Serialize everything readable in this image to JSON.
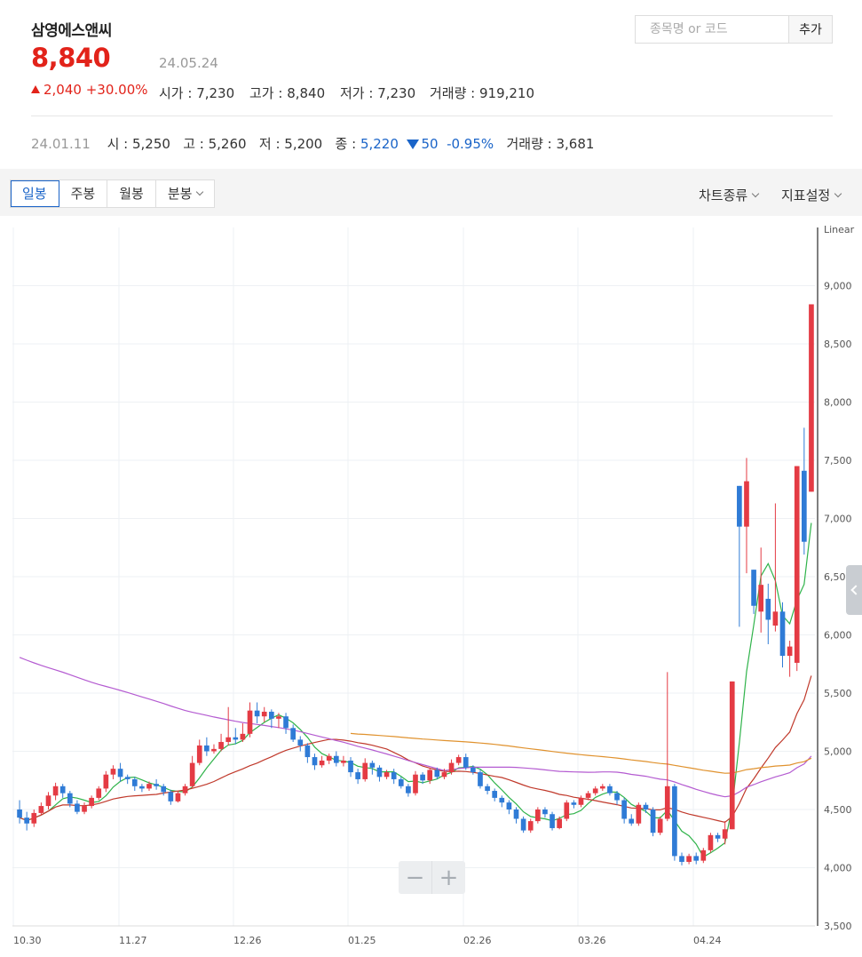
{
  "header": {
    "name": "삼영에스앤씨",
    "price": "8,840",
    "date": "24.05.24",
    "change": "2,040",
    "change_pct": "+30.00%",
    "open": "시가 : 7,230",
    "high": "고가 : 8,840",
    "low": "저가 : 7,230",
    "volume": "거래량 : 919,210"
  },
  "search": {
    "placeholder": "종목명 or 코드",
    "add_label": "추가"
  },
  "hover": {
    "date": "24.01.11",
    "open": "시 : 5,250",
    "high": "고 : 5,260",
    "low": "저 : 5,200",
    "close_label": "종 : ",
    "close": "5,220",
    "change": "50",
    "change_pct": "-0.95%",
    "volume": "거래량 : 3,681"
  },
  "tabs": [
    {
      "label": "일봉",
      "active": true
    },
    {
      "label": "주봉"
    },
    {
      "label": "월봉"
    },
    {
      "label": "분봉",
      "dropdown": true
    }
  ],
  "toolbar_right": {
    "chart_type": "차트종류",
    "indicator": "지표설정"
  },
  "zoom": {
    "minus": "−",
    "plus": "+"
  },
  "colors": {
    "up": "#e43b44",
    "down": "#2f7bd6",
    "ma5": "#2fb34a",
    "ma20": "#c0392b",
    "ma60": "#b45bd1",
    "ma120": "#e0922e"
  },
  "chart_data": {
    "type": "candlestick",
    "scale_label": "Linear",
    "ylim": [
      3500,
      9500
    ],
    "y_ticks": [
      "9,000",
      "8,500",
      "8,000",
      "7,500",
      "7,000",
      "6,500",
      "6,000",
      "5,500",
      "5,000",
      "4,500",
      "4,000",
      "3,500"
    ],
    "x_ticks": [
      "10.30",
      "11.27",
      "12.26",
      "01.25",
      "02.26",
      "03.26",
      "04.24"
    ],
    "candles": [
      [
        4500,
        4430,
        4580,
        4380
      ],
      [
        4430,
        4380,
        4480,
        4320
      ],
      [
        4380,
        4470,
        4500,
        4350
      ],
      [
        4470,
        4530,
        4560,
        4450
      ],
      [
        4530,
        4620,
        4650,
        4500
      ],
      [
        4620,
        4700,
        4730,
        4580
      ],
      [
        4700,
        4640,
        4720,
        4600
      ],
      [
        4640,
        4550,
        4660,
        4520
      ],
      [
        4550,
        4480,
        4580,
        4460
      ],
      [
        4480,
        4530,
        4560,
        4460
      ],
      [
        4530,
        4600,
        4620,
        4510
      ],
      [
        4600,
        4680,
        4700,
        4580
      ],
      [
        4680,
        4800,
        4830,
        4650
      ],
      [
        4800,
        4850,
        4880,
        4760
      ],
      [
        4850,
        4780,
        4900,
        4740
      ],
      [
        4780,
        4760,
        4800,
        4720
      ],
      [
        4760,
        4700,
        4780,
        4660
      ],
      [
        4700,
        4680,
        4720,
        4650
      ],
      [
        4680,
        4720,
        4740,
        4660
      ],
      [
        4720,
        4700,
        4760,
        4670
      ],
      [
        4700,
        4650,
        4720,
        4620
      ],
      [
        4650,
        4570,
        4670,
        4540
      ],
      [
        4570,
        4640,
        4660,
        4560
      ],
      [
        4640,
        4700,
        4720,
        4620
      ],
      [
        4700,
        4900,
        4960,
        4680
      ],
      [
        4900,
        5050,
        5100,
        4880
      ],
      [
        5050,
        5000,
        5120,
        4960
      ],
      [
        5000,
        5020,
        5060,
        4980
      ],
      [
        5020,
        5080,
        5150,
        5000
      ],
      [
        5080,
        5120,
        5380,
        5050
      ],
      [
        5120,
        5100,
        5200,
        5060
      ],
      [
        5100,
        5150,
        5240,
        5080
      ],
      [
        5150,
        5350,
        5420,
        5120
      ],
      [
        5350,
        5300,
        5420,
        5240
      ],
      [
        5300,
        5340,
        5380,
        5250
      ],
      [
        5340,
        5280,
        5360,
        5200
      ],
      [
        5280,
        5300,
        5330,
        5200
      ],
      [
        5300,
        5200,
        5330,
        5150
      ],
      [
        5200,
        5100,
        5230,
        5080
      ],
      [
        5100,
        5050,
        5130,
        5000
      ],
      [
        5050,
        4950,
        5070,
        4900
      ],
      [
        4950,
        4880,
        4980,
        4840
      ],
      [
        4880,
        4920,
        4960,
        4860
      ],
      [
        4920,
        4960,
        4980,
        4890
      ],
      [
        4960,
        4900,
        5000,
        4870
      ],
      [
        4900,
        4920,
        4960,
        4870
      ],
      [
        4920,
        4820,
        4950,
        4780
      ],
      [
        4820,
        4760,
        4850,
        4720
      ],
      [
        4760,
        4900,
        4940,
        4740
      ],
      [
        4900,
        4860,
        4920,
        4800
      ],
      [
        4860,
        4780,
        4880,
        4740
      ],
      [
        4780,
        4820,
        4840,
        4760
      ],
      [
        4820,
        4760,
        4850,
        4720
      ],
      [
        4760,
        4700,
        4780,
        4680
      ],
      [
        4700,
        4640,
        4720,
        4610
      ],
      [
        4640,
        4800,
        4830,
        4620
      ],
      [
        4800,
        4750,
        4820,
        4720
      ],
      [
        4750,
        4840,
        4860,
        4720
      ],
      [
        4840,
        4780,
        4860,
        4760
      ],
      [
        4780,
        4820,
        4850,
        4760
      ],
      [
        4820,
        4900,
        4930,
        4800
      ],
      [
        4900,
        4950,
        4970,
        4880
      ],
      [
        4950,
        4860,
        4980,
        4840
      ],
      [
        4860,
        4820,
        4880,
        4800
      ],
      [
        4820,
        4700,
        4840,
        4680
      ],
      [
        4700,
        4660,
        4720,
        4630
      ],
      [
        4660,
        4600,
        4680,
        4570
      ],
      [
        4600,
        4560,
        4620,
        4520
      ],
      [
        4560,
        4500,
        4580,
        4460
      ],
      [
        4500,
        4420,
        4520,
        4380
      ],
      [
        4420,
        4320,
        4440,
        4300
      ],
      [
        4320,
        4400,
        4420,
        4300
      ],
      [
        4400,
        4500,
        4520,
        4380
      ],
      [
        4500,
        4460,
        4520,
        4430
      ],
      [
        4460,
        4340,
        4480,
        4320
      ],
      [
        4340,
        4420,
        4440,
        4330
      ],
      [
        4420,
        4560,
        4580,
        4400
      ],
      [
        4560,
        4540,
        4580,
        4510
      ],
      [
        4540,
        4600,
        4620,
        4520
      ],
      [
        4600,
        4640,
        4660,
        4580
      ],
      [
        4640,
        4680,
        4700,
        4620
      ],
      [
        4680,
        4700,
        4720,
        4660
      ],
      [
        4700,
        4640,
        4720,
        4620
      ],
      [
        4640,
        4580,
        4660,
        4540
      ],
      [
        4580,
        4420,
        4600,
        4380
      ],
      [
        4420,
        4380,
        4460,
        4360
      ],
      [
        4380,
        4540,
        4560,
        4360
      ],
      [
        4540,
        4500,
        4560,
        4470
      ],
      [
        4500,
        4300,
        4520,
        4270
      ],
      [
        4300,
        4420,
        4440,
        4280
      ],
      [
        4420,
        4700,
        5680,
        4400
      ],
      [
        4700,
        4100,
        4720,
        4060
      ],
      [
        4100,
        4050,
        4130,
        4020
      ],
      [
        4050,
        4100,
        4120,
        4030
      ],
      [
        4100,
        4060,
        4130,
        4030
      ],
      [
        4060,
        4150,
        4170,
        4040
      ],
      [
        4150,
        4280,
        4300,
        4130
      ],
      [
        4280,
        4250,
        4300,
        4220
      ],
      [
        4250,
        4330,
        4400,
        4200
      ],
      [
        4330,
        5600,
        5600,
        4330
      ],
      [
        7280,
        6930,
        7280,
        6070
      ],
      [
        6930,
        7320,
        7520,
        6530
      ],
      [
        6560,
        6250,
        6560,
        6180
      ],
      [
        6200,
        6430,
        6750,
        6020
      ],
      [
        6310,
        6130,
        6440,
        5920
      ],
      [
        6080,
        6200,
        7130,
        6030
      ],
      [
        6200,
        5820,
        6280,
        5720
      ],
      [
        5820,
        5900,
        5950,
        5640
      ],
      [
        5760,
        7450,
        7450,
        5690
      ],
      [
        7410,
        6800,
        7780,
        6690
      ],
      [
        7230,
        8840,
        8840,
        7230
      ]
    ],
    "ma_windows": [
      5,
      20,
      60,
      120
    ]
  }
}
